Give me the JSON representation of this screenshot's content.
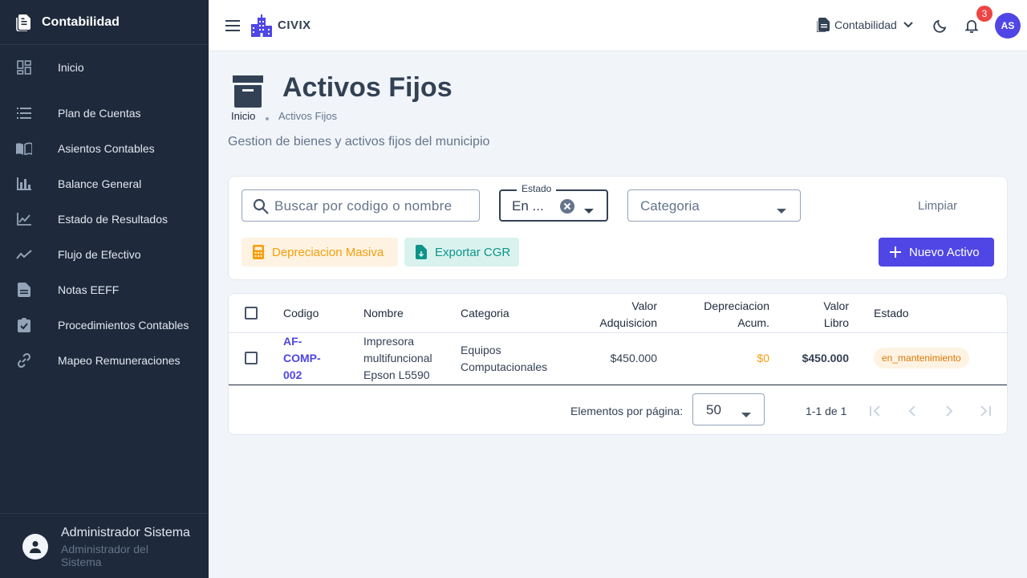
{
  "sidebar": {
    "title": "Contabilidad",
    "items": [
      {
        "label": "Inicio",
        "icon": "dashboard-icon"
      },
      {
        "label": "Plan de Cuentas",
        "icon": "list-icon"
      },
      {
        "label": "Asientos Contables",
        "icon": "book-icon"
      },
      {
        "label": "Balance General",
        "icon": "bar-chart-icon"
      },
      {
        "label": "Estado de Resultados",
        "icon": "line-chart-icon"
      },
      {
        "label": "Flujo de Efectivo",
        "icon": "trend-icon"
      },
      {
        "label": "Notas EEFF",
        "icon": "document-icon"
      },
      {
        "label": "Procedimientos Contables",
        "icon": "clipboard-check-icon"
      },
      {
        "label": "Mapeo Remuneraciones",
        "icon": "link-icon"
      }
    ],
    "user": {
      "name": "Administrador Sistema",
      "role": "Administrador del Sistema"
    }
  },
  "topbar": {
    "brand": "CIVIX",
    "module": "Contabilidad",
    "notifications": "3",
    "avatar_initials": "AS"
  },
  "page": {
    "title": "Activos Fijos",
    "breadcrumb_home": "Inicio",
    "breadcrumb_current": "Activos Fijos",
    "subtitle": "Gestion de bienes y activos fijos del municipio"
  },
  "filters": {
    "search_placeholder": "Buscar por codigo o nombre",
    "estado_label": "Estado",
    "estado_value": "En ...",
    "categoria_placeholder": "Categoria",
    "clear_label": "Limpiar",
    "depreciacion_label": "Depreciacion Masiva",
    "exportar_label": "Exportar CGR",
    "nuevo_label": "Nuevo Activo"
  },
  "table": {
    "headers": {
      "codigo": "Codigo",
      "nombre": "Nombre",
      "categoria": "Categoria",
      "valor_adq_1": "Valor",
      "valor_adq_2": "Adquisicion",
      "dep_1": "Depreciacion",
      "dep_2": "Acum.",
      "libro_1": "Valor",
      "libro_2": "Libro",
      "estado": "Estado"
    },
    "rows": [
      {
        "codigo_lines": [
          "AF-",
          "COMP-",
          "002"
        ],
        "nombre_lines": [
          "Impresora",
          "multifuncional",
          "Epson L5590"
        ],
        "categoria_lines": [
          "Equipos",
          "Computacionales"
        ],
        "valor_adquisicion": "$450.000",
        "depreciacion_acum": "$0",
        "valor_libro": "$450.000",
        "estado": "en_mantenimiento"
      }
    ],
    "paginator": {
      "label": "Elementos por página:",
      "page_size": "50",
      "range": "1-1 de 1"
    }
  },
  "colors": {
    "sidebar_bg": "#1e293b",
    "primary": "#4f46e5",
    "warning": "#f59e0b",
    "teal": "#0d9488",
    "danger": "#ef4444"
  }
}
